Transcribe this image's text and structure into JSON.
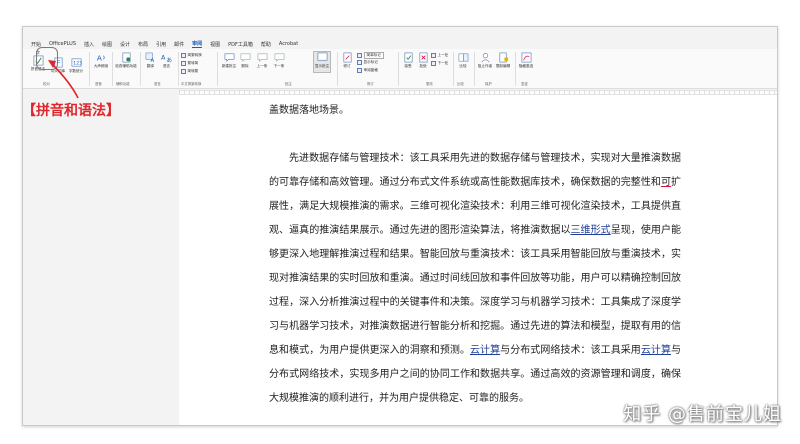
{
  "ribbon_tabs": [
    "开始",
    "OfficePLUS",
    "插入",
    "绘图",
    "设计",
    "布局",
    "引用",
    "邮件",
    "审阅",
    "视图",
    "PDF工具箱",
    "帮助",
    "Acrobat"
  ],
  "active_tab": "审阅",
  "ribbon": {
    "pinyin_top": "字",
    "pinyin_grammar": "拼音语法",
    "thesaurus": "同义词库",
    "word_count": "字数统计",
    "read_aloud": "大声朗读",
    "check_accessibility": "检查辅助功能",
    "translate": "翻译",
    "language": "语言",
    "simp_trad": "简繁转换",
    "simp_to_trad": "繁转简",
    "trad_to_simp": "简转繁",
    "new_comment": "新建批注",
    "delete": "删除",
    "previous": "上一条",
    "next": "下一条",
    "show_comments": "显示批注",
    "track_changes": "修订",
    "simple_markup": "简单标记",
    "show_markup": "显示标记",
    "reviewing_pane": "审阅窗格",
    "accept": "接受",
    "reject": "拒绝",
    "prev_change": "上一处",
    "next_change": "下一处",
    "compare": "比较",
    "block_authors": "阻止作者",
    "restrict_editing": "限制编辑",
    "hide_ink": "隐藏墨迹",
    "group_proofing": "校对",
    "group_speech": "语音",
    "group_accessibility": "辅助功能",
    "group_language": "语言",
    "group_chinese_conversion": "中文简繁转换",
    "group_comments": "批注",
    "group_tracking": "修订",
    "group_changes": "更改",
    "group_compare": "比较",
    "group_protect": "保护",
    "group_ink": "墨迹"
  },
  "callout_label": "【拼音和语法】",
  "document": {
    "line0": "盖数据落地场景。",
    "p1_a": "先进数据存储与管理技术：该工具采用先进的数据存储与管理技术，实现对大量推演数据的可靠存储和高效管理。通过分布式文件系统或高性能数据库技术，确保数据的完整性和",
    "p1_err": "可",
    "p1_b": "扩展性，满足大规模推演的需求。三维可视化渲染技术：利用三维可视化渲染技术，工具提供直观、逼真的推演结果展示。通过先进的图形渲染算法，将推演数据以",
    "p1_link1": "三维形式",
    "p1_c": "呈现，使用户能够更深入地理解推演过程和结果。智能回放与重演技术：该工具采用智能回放与重演技术，实现对推演结果的实时回放和重演。通过时间线回放和事件回放等功能，用户可以精确控制回放过程，深入分析推演过程中的关键事件和决策。深度学习与机器学习技术：工具集成了深度学习与机器学习技术，对推演数据进行智能分析和挖掘。通过先进的算法和模型，提取有用的信息和模式，为用户提供更深入的洞察和预测。",
    "p1_link2": "云计算",
    "p1_d": "与分布式网络技术：该工具采用",
    "p1_link3": "云计算",
    "p1_e": "与分布式网络技术，实现多用户之间的协同工作和数据共享。通过高效的资源管理和调度，确保大规模推演的顺利进行，并为用户提供稳定、可靠的服务。"
  },
  "watermark": "知乎 @售前宝儿姐"
}
